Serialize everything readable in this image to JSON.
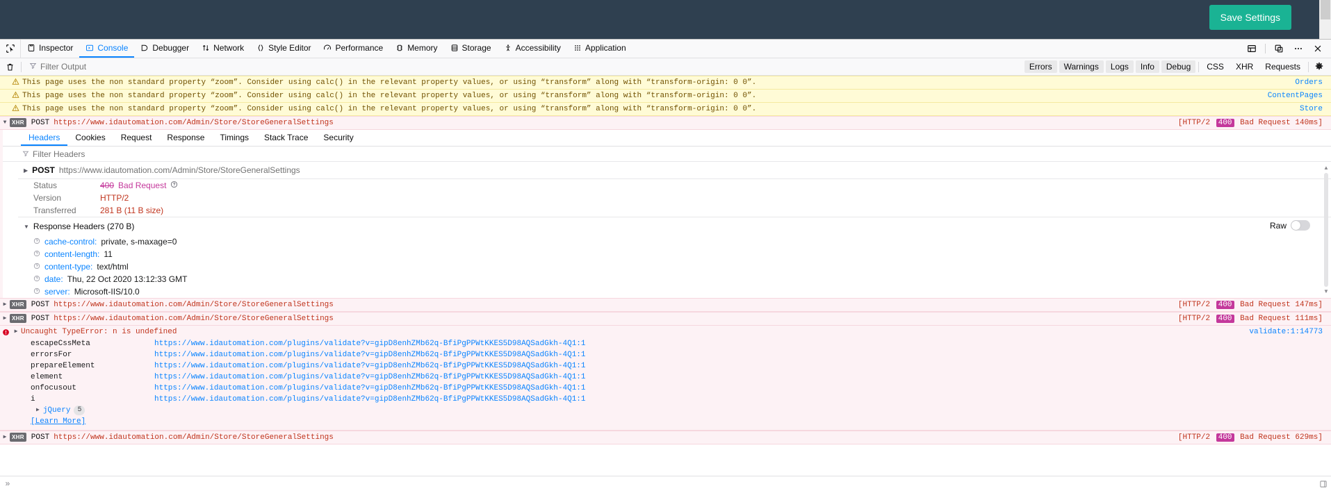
{
  "site_header": {
    "save_button_label": "Save Settings",
    "accent_color": "#1ab394",
    "background_color": "#2f4050"
  },
  "devtools": {
    "picker_icon": "element-picker-icon",
    "tabs": [
      {
        "label": "Inspector",
        "icon": "inspector-icon",
        "selected": false
      },
      {
        "label": "Console",
        "icon": "console-icon",
        "selected": true
      },
      {
        "label": "Debugger",
        "icon": "debugger-icon",
        "selected": false
      },
      {
        "label": "Network",
        "icon": "network-icon",
        "selected": false
      },
      {
        "label": "Style Editor",
        "icon": "style-editor-icon",
        "selected": false
      },
      {
        "label": "Performance",
        "icon": "performance-icon",
        "selected": false
      },
      {
        "label": "Memory",
        "icon": "memory-icon",
        "selected": false
      },
      {
        "label": "Storage",
        "icon": "storage-icon",
        "selected": false
      },
      {
        "label": "Accessibility",
        "icon": "accessibility-icon",
        "selected": false
      },
      {
        "label": "Application",
        "icon": "application-icon",
        "selected": false
      }
    ],
    "toolbar_buttons": [
      {
        "name": "split-console-icon"
      },
      {
        "name": "responsive-design-mode-icon"
      },
      {
        "name": "meatball-menu-icon"
      },
      {
        "name": "close-devtools-icon"
      }
    ]
  },
  "console_toolbar": {
    "clear_icon": "trash-icon",
    "filter_icon": "funnel-icon",
    "filter_placeholder": "Filter Output",
    "filter_value": "",
    "level_filters": [
      "Errors",
      "Warnings",
      "Logs",
      "Info",
      "Debug"
    ],
    "type_filters": [
      "CSS",
      "XHR",
      "Requests"
    ],
    "settings_icon": "gear-icon"
  },
  "messages": {
    "warning_text": "This page uses the non standard property “zoom”. Consider using calc() in the relevant property values, or using “transform” along with “transform-origin: 0 0”.",
    "warnings": [
      {
        "source": "Orders"
      },
      {
        "source": "ContentPages"
      },
      {
        "source": "Store"
      }
    ],
    "xhr_badge": "XHR",
    "method": "POST",
    "url": "https://www.idautomation.com/Admin/Store/StoreGeneralSettings",
    "requests": [
      {
        "protocol": "[HTTP/2",
        "code": "400",
        "phrase": "Bad Request",
        "time": "140ms]",
        "expanded": true
      },
      {
        "protocol": "[HTTP/2",
        "code": "400",
        "phrase": "Bad Request",
        "time": "147ms]",
        "expanded": false
      },
      {
        "protocol": "[HTTP/2",
        "code": "400",
        "phrase": "Bad Request",
        "time": "111ms]",
        "expanded": false
      },
      {
        "protocol": "[HTTP/2",
        "code": "400",
        "phrase": "Bad Request",
        "time": "629ms]",
        "expanded": false
      }
    ]
  },
  "net_panel": {
    "tabs": [
      "Headers",
      "Cookies",
      "Request",
      "Response",
      "Timings",
      "Stack Trace",
      "Security"
    ],
    "selected_tab": "Headers",
    "filter_placeholder": "Filter Headers",
    "filter_value": "",
    "summary": {
      "method": "POST",
      "url": "https://www.idautomation.com/Admin/Store/StoreGeneralSettings"
    },
    "fields": [
      {
        "key": "Status",
        "code": "400",
        "phrase": "Bad Request",
        "help": true
      },
      {
        "key": "Version",
        "value": "HTTP/2"
      },
      {
        "key": "Transferred",
        "value": "281 B (11 B size)"
      }
    ],
    "response_headers_title": "Response Headers (270 B)",
    "raw_label": "Raw",
    "raw_enabled": false,
    "response_headers": [
      {
        "name": "cache-control:",
        "value": "private, s-maxage=0"
      },
      {
        "name": "content-length:",
        "value": "11"
      },
      {
        "name": "content-type:",
        "value": "text/html"
      },
      {
        "name": "date:",
        "value": "Thu, 22 Oct 2020 13:12:33 GMT"
      },
      {
        "name": "server:",
        "value": "Microsoft-IIS/10.0"
      }
    ]
  },
  "error_block": {
    "icon": "error-icon",
    "title": "Uncaught TypeError: n is undefined",
    "source_link": "validate:1:14773",
    "stack_url": "https://www.idautomation.com/plugins/validate?v=gipD8enhZMb62q-BfiPgPPWtKKES5D98AQSadGkh-4Q1:1",
    "frames": [
      {
        "fn": "escapeCssMeta"
      },
      {
        "fn": "errorsFor"
      },
      {
        "fn": "prepareElement"
      },
      {
        "fn": "element"
      },
      {
        "fn": "onfocusout"
      },
      {
        "fn": "i"
      }
    ],
    "group": {
      "name": "jQuery",
      "count": "5"
    },
    "learn_more": "[Learn More]"
  },
  "prompt": {
    "chevron": "»",
    "value": "",
    "corner_icon": "editor-mode-icon"
  }
}
